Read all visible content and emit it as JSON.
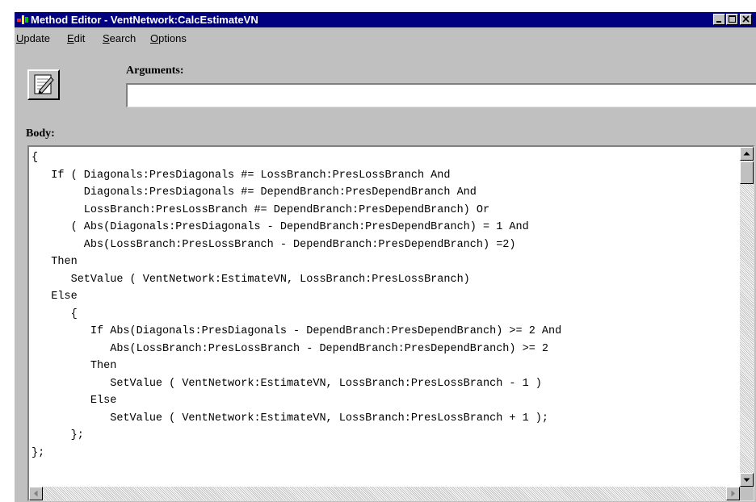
{
  "window": {
    "title": "Method Editor - VentNetwork:CalcEstimateVN",
    "accent": "#000080"
  },
  "menu": {
    "items": [
      {
        "accel": "U",
        "rest": "pdate"
      },
      {
        "accel": "E",
        "rest": "dit"
      },
      {
        "accel": "S",
        "rest": "earch"
      },
      {
        "accel": "O",
        "rest": "ptions"
      }
    ]
  },
  "arguments": {
    "label": "Arguments:",
    "value": ""
  },
  "body": {
    "label": "Body:",
    "lines": [
      "{",
      "   If ( Diagonals:PresDiagonals #= LossBranch:PresLossBranch And",
      "        Diagonals:PresDiagonals #= DependBranch:PresDependBranch And",
      "        LossBranch:PresLossBranch #= DependBranch:PresDependBranch) Or",
      "      ( Abs(Diagonals:PresDiagonals - DependBranch:PresDependBranch) = 1 And",
      "        Abs(LossBranch:PresLossBranch - DependBranch:PresDependBranch) =2)",
      "   Then",
      "      SetValue ( VentNetwork:EstimateVN, LossBranch:PresLossBranch)",
      "   Else",
      "      {",
      "         If Abs(Diagonals:PresDiagonals - DependBranch:PresDependBranch) >= 2 And",
      "            Abs(LossBranch:PresLossBranch - DependBranch:PresDependBranch) >= 2",
      "         Then",
      "            SetValue ( VentNetwork:EstimateVN, LossBranch:PresLossBranch - 1 )",
      "         Else",
      "            SetValue ( VentNetwork:EstimateVN, LossBranch:PresLossBranch + 1 );",
      "      };",
      "};"
    ]
  }
}
